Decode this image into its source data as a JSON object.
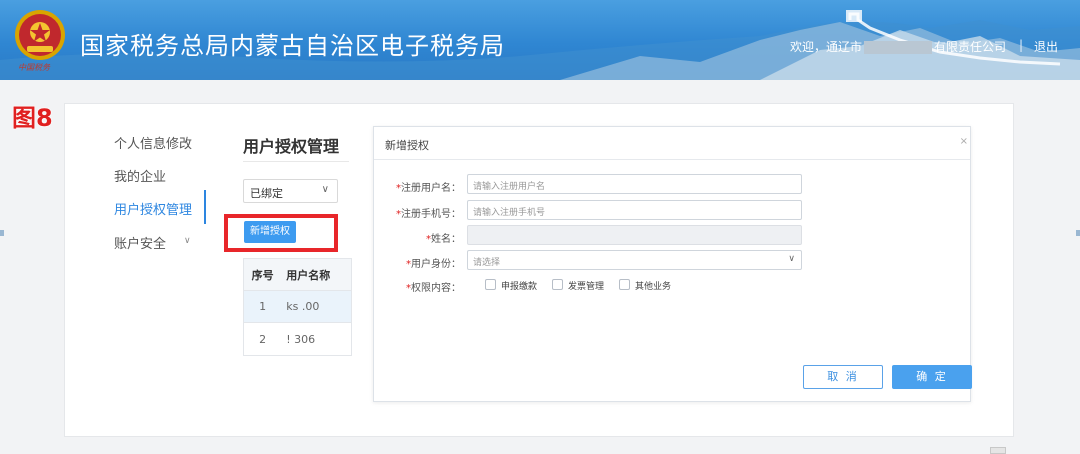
{
  "header": {
    "site_title": "国家税务总局内蒙古自治区电子税务局",
    "emblem_text": "中国税务",
    "welcome_prefix": "欢迎，通辽市",
    "welcome_suffix": "有限责任公司",
    "separator": "|",
    "logout_label": "退出"
  },
  "figure_tag": "图8",
  "sidebar": {
    "items": [
      {
        "label": "个人信息修改"
      },
      {
        "label": "我的企业"
      },
      {
        "label": "用户授权管理"
      },
      {
        "label": "账户安全"
      }
    ]
  },
  "panel": {
    "title": "用户授权管理",
    "status_select": {
      "value": "已绑定"
    },
    "add_button_label": "新增授权",
    "table": {
      "columns": [
        "序号",
        "用户名称"
      ],
      "rows": [
        [
          "1",
          "ks    .00"
        ],
        [
          "2",
          "!     306"
        ]
      ]
    }
  },
  "dialog": {
    "title": "新增授权",
    "close_icon": "×",
    "fields": {
      "username": {
        "label": "注册用户名：",
        "placeholder": "请输入注册用户名"
      },
      "phone": {
        "label": "注册手机号：",
        "placeholder": "请输入注册手机号"
      },
      "name": {
        "label": "姓名：",
        "value": ""
      },
      "identity": {
        "label": "用户身份：",
        "placeholder": "请选择"
      },
      "permissions": {
        "label": "权限内容："
      }
    },
    "permission_options": [
      "申报缴款",
      "发票管理",
      "其他业务"
    ],
    "cancel_label": "取 消",
    "ok_label": "确 定"
  },
  "colors": {
    "header_blue": "#2f86d2",
    "accent_blue": "#3d9bf0",
    "highlight_red": "#e8262a"
  }
}
